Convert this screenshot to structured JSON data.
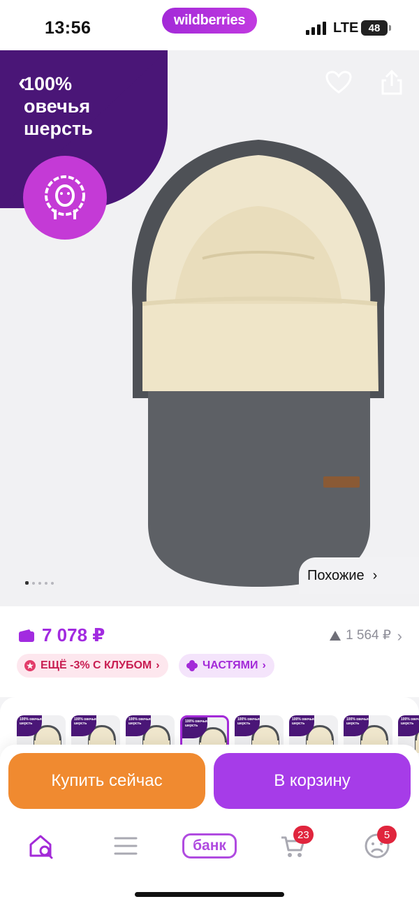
{
  "status_bar": {
    "time": "13:56",
    "app_pill": "wildberries",
    "network": "LTE",
    "battery": "48"
  },
  "promo": {
    "line1": "100%",
    "line2": "овечья",
    "line3": "шерсть",
    "badge_icon": "sheep-icon"
  },
  "gallery": {
    "similar_label": "Похожие",
    "dots_count": 5,
    "active_dot": 0
  },
  "price": {
    "current": "7 078 ₽",
    "secondary": "1 564 ₽",
    "chips": {
      "club": "ЕЩЁ -3% С КЛУБОМ",
      "parts": "ЧАСТЯМИ"
    }
  },
  "thumbnails": {
    "count": 8,
    "selected_index": 3,
    "corner_text": "100% овечья шерсть"
  },
  "actions": {
    "buy_now": "Купить сейчас",
    "to_cart": "В корзину"
  },
  "nav": {
    "bank_label": "банк",
    "cart_badge": "23",
    "profile_badge": "5"
  },
  "colors": {
    "accent": "#a32ad8",
    "buy_now": "#f08a30",
    "cart_button": "#a63ce8",
    "promo_bg": "#4a1677",
    "badge_red": "#e0253d"
  }
}
